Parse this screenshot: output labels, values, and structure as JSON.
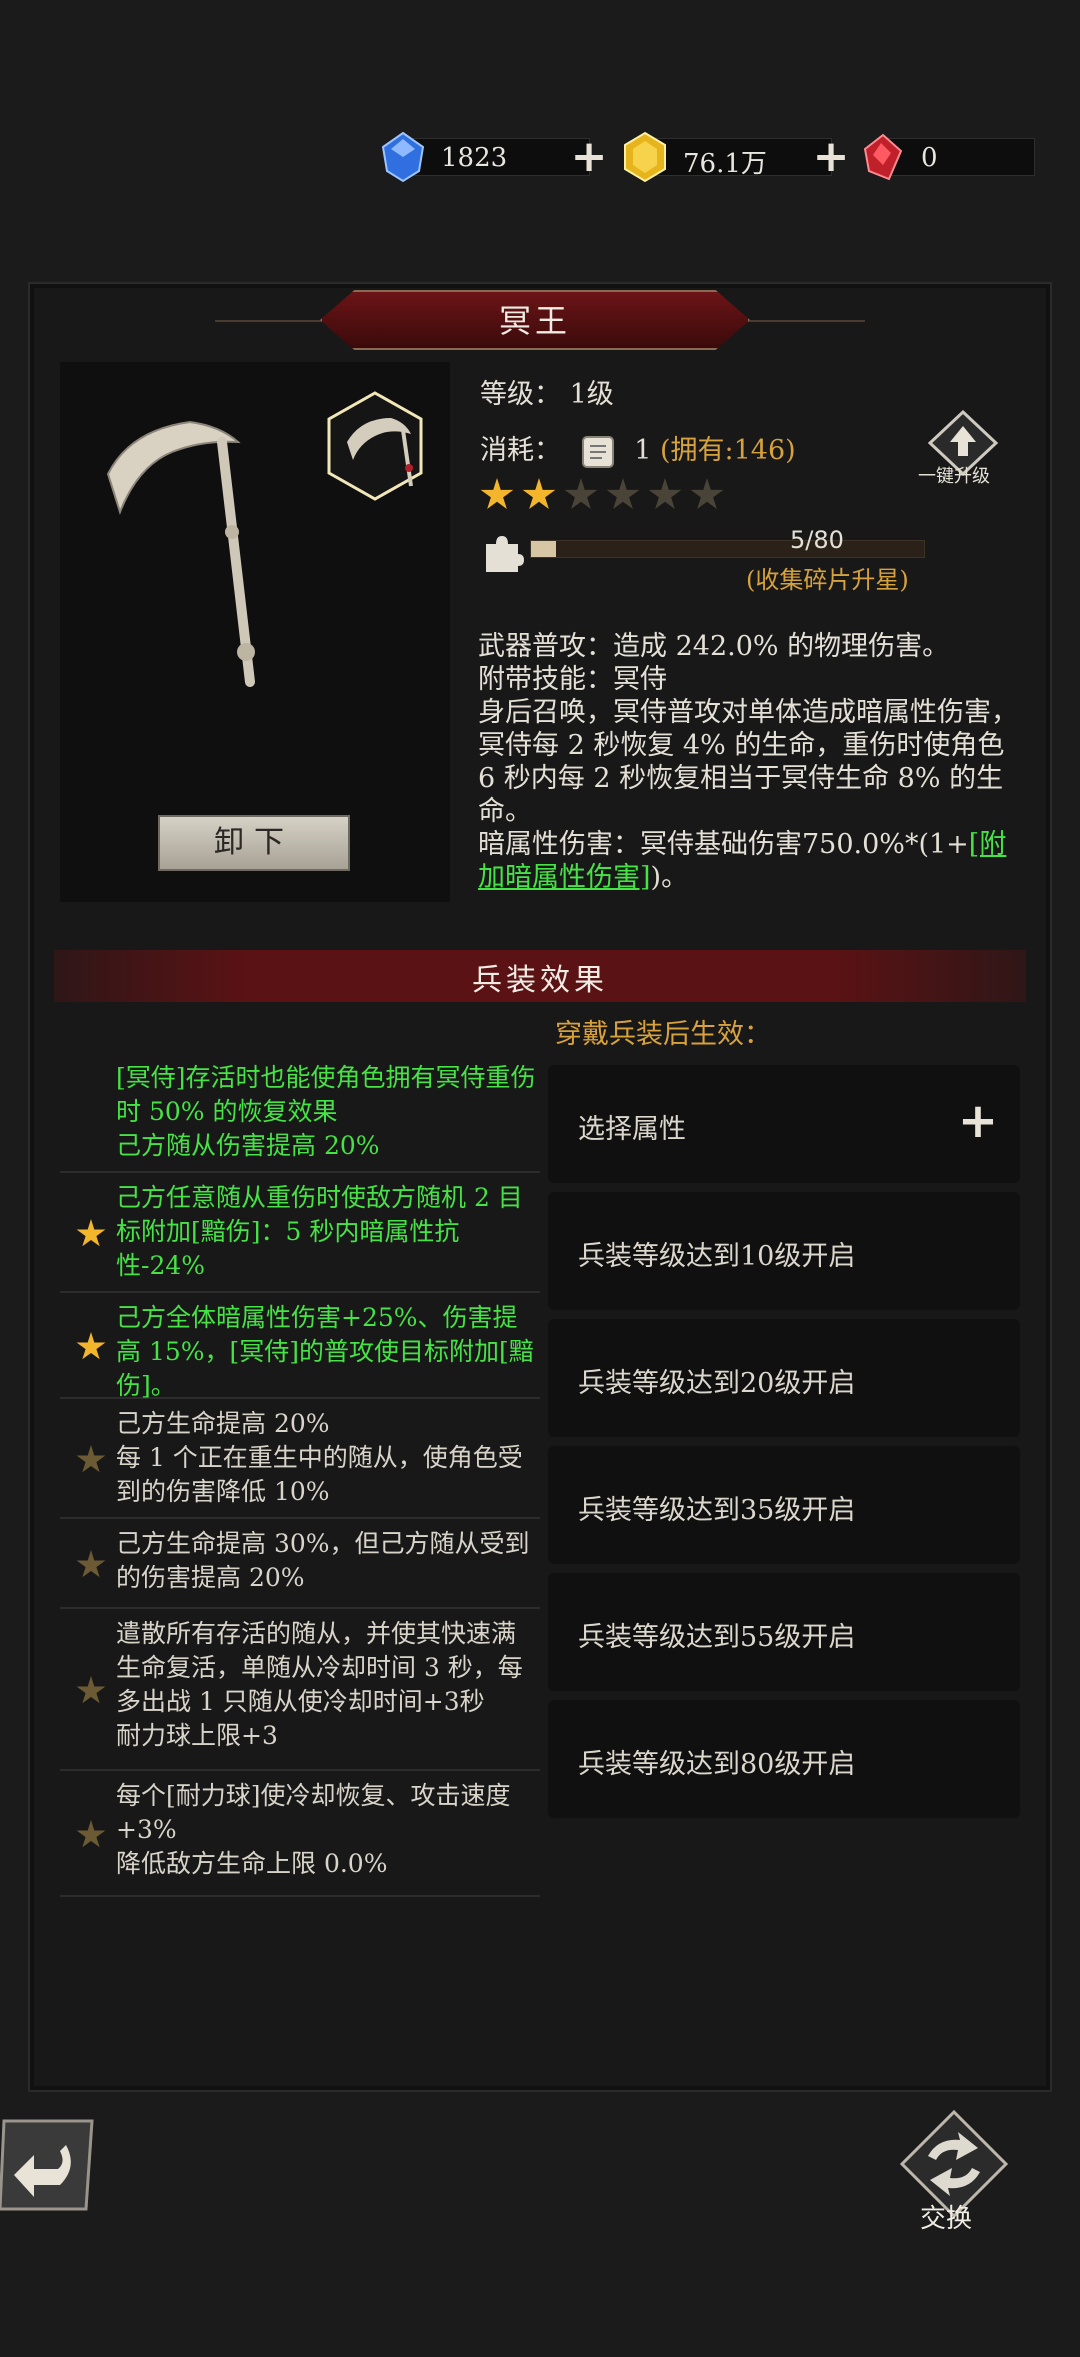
{
  "currency": [
    {
      "icon": "blue-gem-icon",
      "value": "1823"
    },
    {
      "icon": "gold-gem-icon",
      "value": "76.1万"
    },
    {
      "icon": "red-gem-icon",
      "value": "0"
    }
  ],
  "weapon": {
    "name": "冥王",
    "level_label": "等级：",
    "level": "1级",
    "cost_label": "消耗：",
    "cost_count": "1",
    "owned": "(拥有:146)",
    "stars_total": 6,
    "stars_filled": 2,
    "fragments_text": "5/80",
    "fragments_progress": 0.0625,
    "collect_link": "(收集碎片升星)",
    "upgrade_label": "一键升级",
    "unequip_label": "卸下"
  },
  "description": {
    "line1": "武器普攻：造成 242.0% 的物理伤害。",
    "line2": "附带技能：冥侍",
    "line3": "身后召唤，冥侍普攻对单体造成暗属性伤害，冥侍每 2 秒恢复 4% 的生命，重伤时使角色 6 秒内每 2 秒恢复相当于冥侍生命 8% 的生命。",
    "line4a": "暗属性伤害：冥侍基础伤害750.0%*(1+",
    "line4_link": "[附加暗属性伤害]",
    "line4b": ")。"
  },
  "section": {
    "title": "兵装效果",
    "subtitle": "穿戴兵装后生效："
  },
  "effects": [
    {
      "text": "[冥侍]存活时也能使角色拥有冥侍重伤时 50% 的恢复效果\n己方随从伤害提高 20%",
      "active": true,
      "star": false
    },
    {
      "text": "己方任意随从重伤时使敌方随机 2 目标附加[黯伤]：5 秒内暗属性抗性-24%",
      "active": true,
      "star": true
    },
    {
      "text": "己方全体暗属性伤害+25%、伤害提高 15%，[冥侍]的普攻使目标附加[黯伤]。",
      "active": true,
      "star": true
    },
    {
      "text": "己方生命提高 20%\n每 1 个正在重生中的随从，使角色受到的伤害降低 10%",
      "active": false,
      "star": true
    },
    {
      "text": "己方生命提高 30%，但己方随从受到的伤害提高 20%",
      "active": false,
      "star": true
    },
    {
      "text": "遣散所有存活的随从，并使其快速满生命复活，单随从冷却时间 3 秒，每多出战 1 只随从使冷却时间+3秒\n耐力球上限+3",
      "active": false,
      "star": true
    },
    {
      "text": "每个[耐力球]使冷却恢复、攻击速度+3%\n降低敌方生命上限 0.0%",
      "active": false,
      "star": true
    }
  ],
  "slots": [
    {
      "label": "选择属性",
      "has_add": true
    },
    {
      "label": "兵装等级达到10级开启",
      "has_add": false
    },
    {
      "label": "兵装等级达到20级开启",
      "has_add": false
    },
    {
      "label": "兵装等级达到35级开启",
      "has_add": false
    },
    {
      "label": "兵装等级达到55级开启",
      "has_add": false
    },
    {
      "label": "兵装等级达到80级开启",
      "has_add": false
    }
  ],
  "bottom": {
    "swap_label": "交换"
  },
  "colors": {
    "active_effect": "#46e246",
    "inactive_effect": "#d9d4ca",
    "star_active": "#f2b52c",
    "star_inactive": "#6b5a34",
    "accent_red": "#5b1214",
    "gold": "#d7a23e"
  }
}
